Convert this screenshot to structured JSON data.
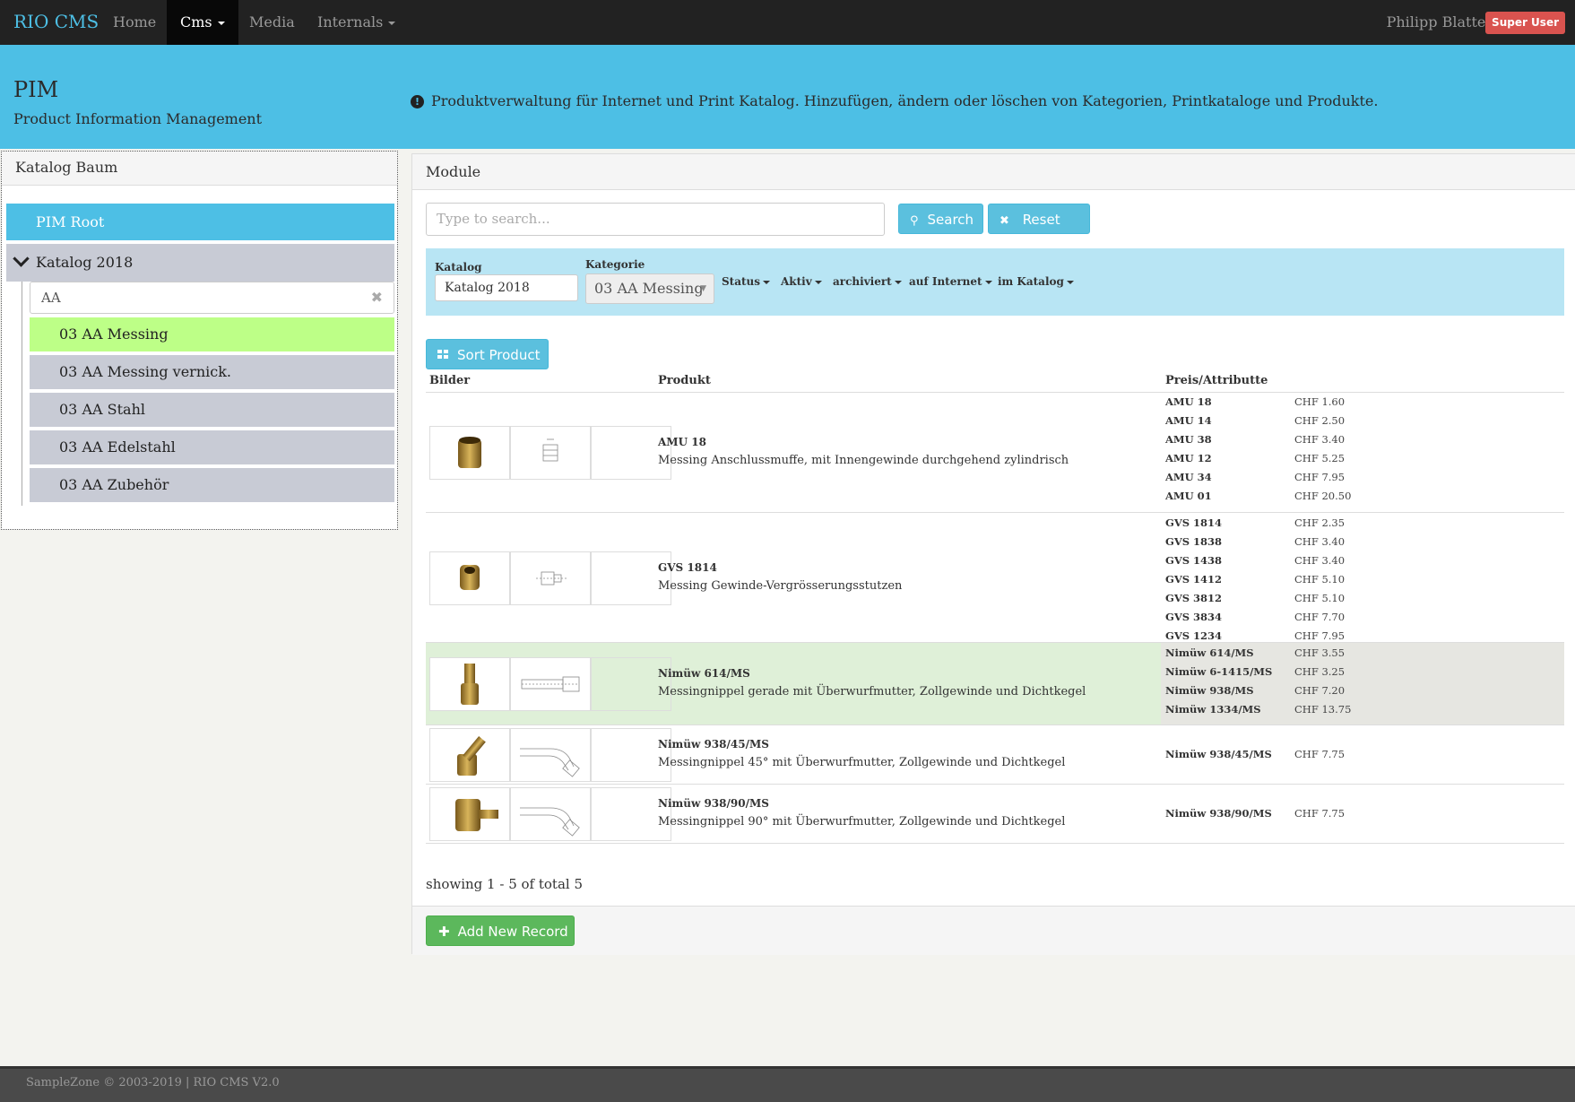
{
  "nav": {
    "brand": "RIO CMS",
    "items": [
      {
        "label": "Home",
        "dropdown": false,
        "active": false
      },
      {
        "label": "Cms",
        "dropdown": true,
        "active": true
      },
      {
        "label": "Media",
        "dropdown": false,
        "active": false
      },
      {
        "label": "Internals",
        "dropdown": true,
        "active": false
      }
    ],
    "user_name": "Philipp Blatter",
    "user_badge": "Super User"
  },
  "header": {
    "title": "PIM",
    "subtitle": "Product Information Management",
    "info": "Produktverwaltung für Internet und Print Katalog. Hinzufügen, ändern oder löschen von Kategorien, Printkataloge und Produkte.",
    "info_icon": "exclamation-circle-icon"
  },
  "tree": {
    "title": "Katalog Baum",
    "root": "PIM Root",
    "catalog": "Katalog 2018",
    "filter_value": "AA",
    "items": [
      {
        "label": "03 AA Messing",
        "selected": true
      },
      {
        "label": "03 AA Messing vernick.",
        "selected": false
      },
      {
        "label": "03 AA Stahl",
        "selected": false
      },
      {
        "label": "03 AA Edelstahl",
        "selected": false
      },
      {
        "label": "03 AA Zubehör",
        "selected": false
      }
    ]
  },
  "module": {
    "title": "Module",
    "search_placeholder": "Type to search...",
    "search_button": "Search",
    "reset_button": "Reset",
    "filters": {
      "katalog_label": "Katalog",
      "katalog_value": "Katalog 2018",
      "kategorie_label": "Kategorie",
      "kategorie_value": "03 AA Messing",
      "dropdowns": [
        "Status",
        "Aktiv",
        "archiviert",
        "auf Internet",
        "im Katalog"
      ]
    },
    "sort_button": "Sort Product",
    "columns": {
      "images": "Bilder",
      "product": "Produkt",
      "prices": "Preis/Attributte"
    },
    "products": [
      {
        "name": "AMU 18",
        "desc": "Messing Anschlussmuffe, mit Innengewinde durchgehend zylindrisch",
        "highlight": false,
        "prices": [
          {
            "code": "AMU 18",
            "price": "CHF 1.60"
          },
          {
            "code": "AMU 14",
            "price": "CHF 2.50"
          },
          {
            "code": "AMU 38",
            "price": "CHF 3.40"
          },
          {
            "code": "AMU 12",
            "price": "CHF 5.25"
          },
          {
            "code": "AMU 34",
            "price": "CHF 7.95"
          },
          {
            "code": "AMU 01",
            "price": "CHF 20.50"
          }
        ]
      },
      {
        "name": "GVS 1814",
        "desc": "Messing Gewinde-Vergrösserungsstutzen",
        "highlight": false,
        "prices": [
          {
            "code": "GVS 1814",
            "price": "CHF 2.35"
          },
          {
            "code": "GVS 1838",
            "price": "CHF 3.40"
          },
          {
            "code": "GVS 1438",
            "price": "CHF 3.40"
          },
          {
            "code": "GVS 1412",
            "price": "CHF 5.10"
          },
          {
            "code": "GVS 3812",
            "price": "CHF 5.10"
          },
          {
            "code": "GVS 3834",
            "price": "CHF 7.70"
          },
          {
            "code": "GVS 1234",
            "price": "CHF 7.95"
          }
        ]
      },
      {
        "name": "Nimüw 614/MS",
        "desc": "Messingnippel gerade mit Überwurfmutter, Zollgewinde und Dichtkegel",
        "highlight": true,
        "prices": [
          {
            "code": "Nimüw 614/MS",
            "price": "CHF 3.55"
          },
          {
            "code": "Nimüw 6-1415/MS",
            "price": "CHF 3.25"
          },
          {
            "code": "Nimüw 938/MS",
            "price": "CHF 7.20"
          },
          {
            "code": "Nimüw 1334/MS",
            "price": "CHF 13.75"
          }
        ]
      },
      {
        "name": "Nimüw 938/45/MS",
        "desc": "Messingnippel 45° mit Überwurfmutter, Zollgewinde und Dichtkegel",
        "highlight": false,
        "prices": [
          {
            "code": "Nimüw 938/45/MS",
            "price": "CHF 7.75"
          }
        ]
      },
      {
        "name": "Nimüw 938/90/MS",
        "desc": "Messingnippel 90° mit Überwurfmutter, Zollgewinde und Dichtkegel",
        "highlight": false,
        "prices": [
          {
            "code": "Nimüw 938/90/MS",
            "price": "CHF 7.75"
          }
        ]
      }
    ],
    "showing": "showing 1 - 5 of total 5",
    "add_button": "Add New Record"
  },
  "footer": "SampleZone © 2003-2019 | RIO CMS V2.0",
  "colors": {
    "accent": "#4dbfe5",
    "selected": "#bdff87",
    "danger": "#d9534f",
    "success": "#5cb85c"
  }
}
